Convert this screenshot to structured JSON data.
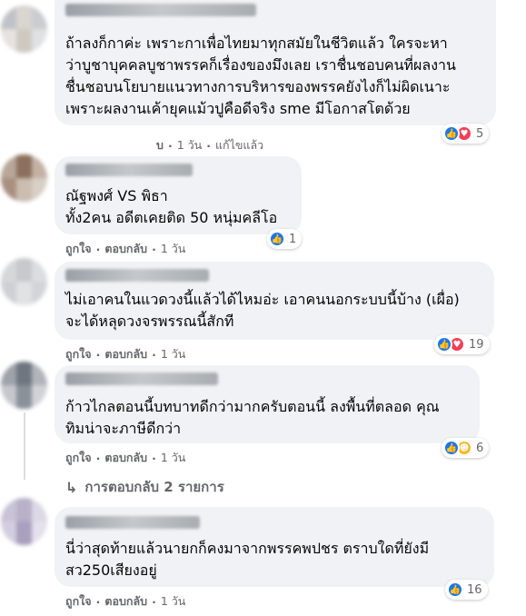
{
  "comments": [
    {
      "lines": [
        "ถ้าลงก็กาค่ะ เพราะกาเพื่อไทยมาทุกสมัยในชีวิตแล้ว ใครจะหา",
        "ว่าบูชาบุคคลบูชาพรรคก็เรื่องของมึงเลย เราชื่นชอบคนที่ผลงาน",
        "ชื่นชอบนโยบายแนวทางการบริหารของพรรคยังไงก็ไม่ผิดเนาะ",
        "เพราะผลงานเค้ายุคแม้วปูคือดีจริง sme มีโอกาสโตด้วย"
      ],
      "actions": {
        "reply_partial": "บ",
        "time": "1 วัน",
        "edited": "แก้ไขแล้ว"
      },
      "reactions": {
        "icons": [
          "like-icon",
          "love-icon"
        ],
        "count": "5"
      }
    },
    {
      "lines": [
        "ณัฐพงศ์ VS พิธา",
        "ทั้ง2คน อดีตเคยติด 50 หนุ่มคลีโอ"
      ],
      "actions": {
        "like": "ถูกใจ",
        "reply": "ตอบกลับ",
        "time": "1 วัน"
      },
      "reactions": {
        "icons": [
          "like-icon"
        ],
        "count": "1"
      }
    },
    {
      "lines": [
        "ไม่เอาคนในแวดวงนี้แล้วได้ไหมอ่ะ เอาคนนอกระบบนี้บ้าง (เผื่อ)",
        "จะได้หลุดวงจรพรรณนี้สักที"
      ],
      "actions": {
        "like": "ถูกใจ",
        "reply": "ตอบกลับ",
        "time": "1 วัน"
      },
      "reactions": {
        "icons": [
          "like-icon",
          "love-icon"
        ],
        "count": "19"
      }
    },
    {
      "lines": [
        "ก้าวไกลตอนนี้บทบาทดีกว่ามากครับตอนนี้ ลงพื้นที่ตลอด คุณ",
        "ทิมน่าจะภาษีดีกว่า"
      ],
      "actions": {
        "like": "ถูกใจ",
        "reply": "ตอบกลับ",
        "time": "1 วัน"
      },
      "reactions": {
        "icons": [
          "like-icon",
          "haha-icon"
        ],
        "count": "6"
      },
      "replies_link": "การตอบกลับ 2 รายการ"
    },
    {
      "lines": [
        "นี่ว่าสุดท้ายแล้วนายกก็คงมาจากพรรคพปชร ตราบใดที่ยังมี",
        "สว250เสียงอยู่"
      ],
      "actions": {
        "like": "ถูกใจ",
        "reply": "ตอบกลับ",
        "time": "1 วัน"
      },
      "reactions": {
        "icons": [
          "like-icon"
        ],
        "count": "16"
      }
    }
  ],
  "colors": {
    "bubble": "#f0f2f5",
    "muted_text": "#65676b",
    "like_blue": "#1877f2",
    "love_red": "#f33e58",
    "haha_yellow": "#f7b928"
  }
}
